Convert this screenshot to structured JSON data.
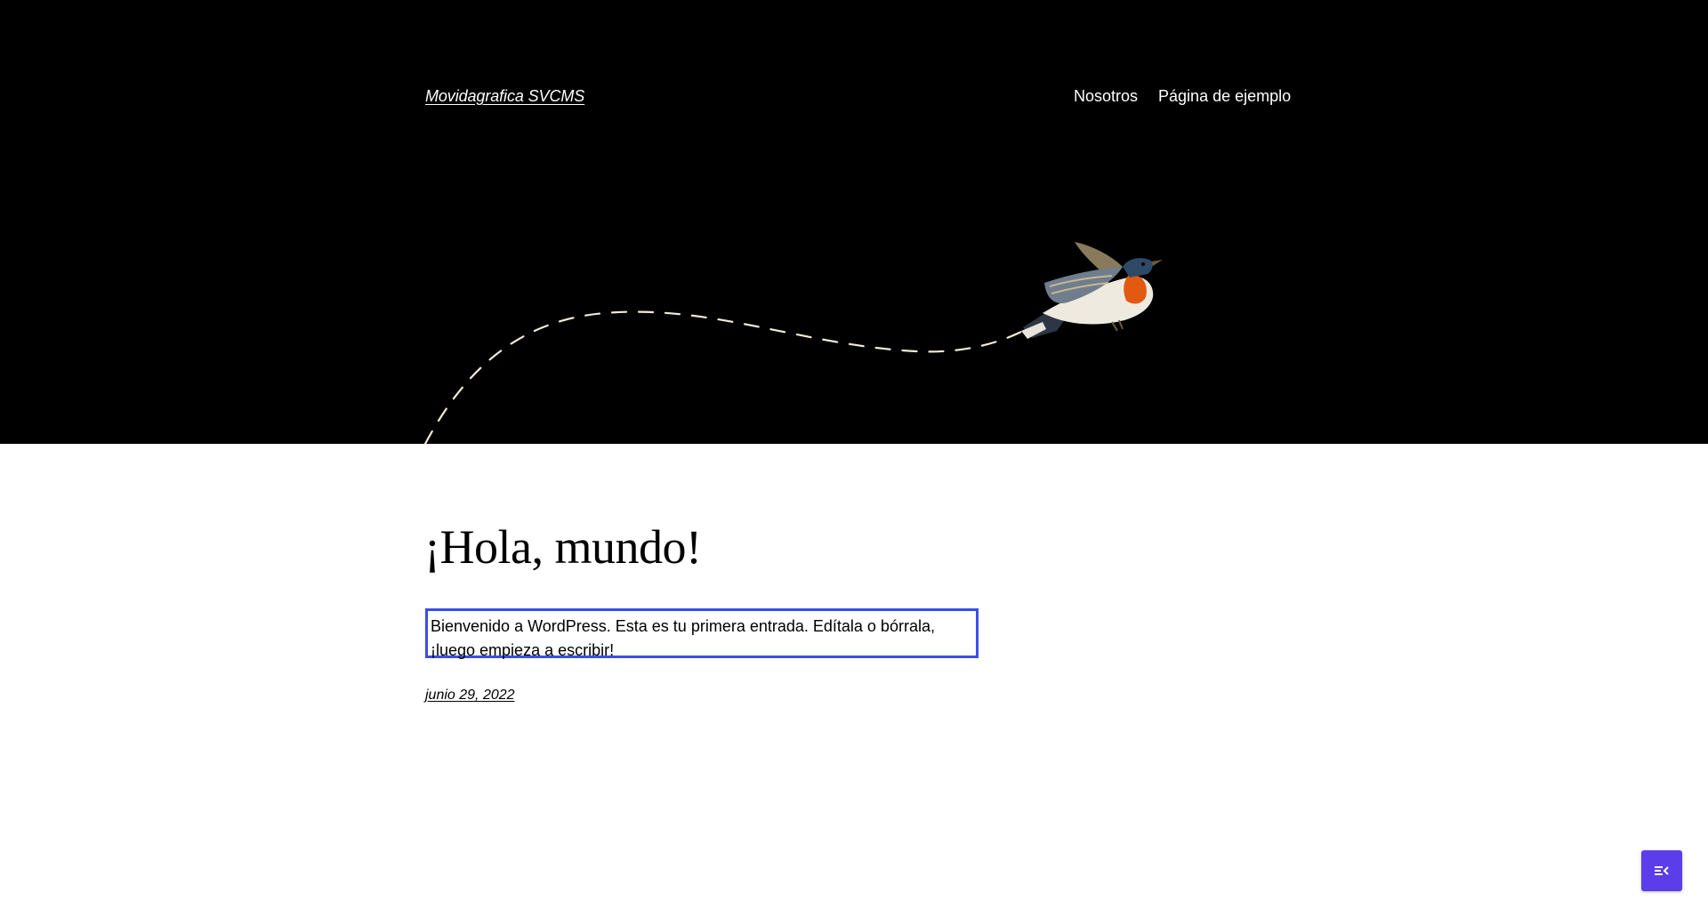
{
  "header": {
    "site_title": "Movidagrafica SVCMS",
    "nav": [
      {
        "label": "Nosotros"
      },
      {
        "label": "Página de ejemplo"
      }
    ]
  },
  "post": {
    "title": "¡Hola, mundo!",
    "excerpt": "Bienvenido a WordPress. Esta es tu primera entrada. Edítala o bórrala, ¡luego empieza a escribir!",
    "date": "junio 29, 2022"
  },
  "floating_button": {
    "icon": "menu-collapse-icon",
    "color": "#5b3dea"
  },
  "colors": {
    "header_bg": "#000000",
    "highlight_border": "#3b4ee8"
  }
}
